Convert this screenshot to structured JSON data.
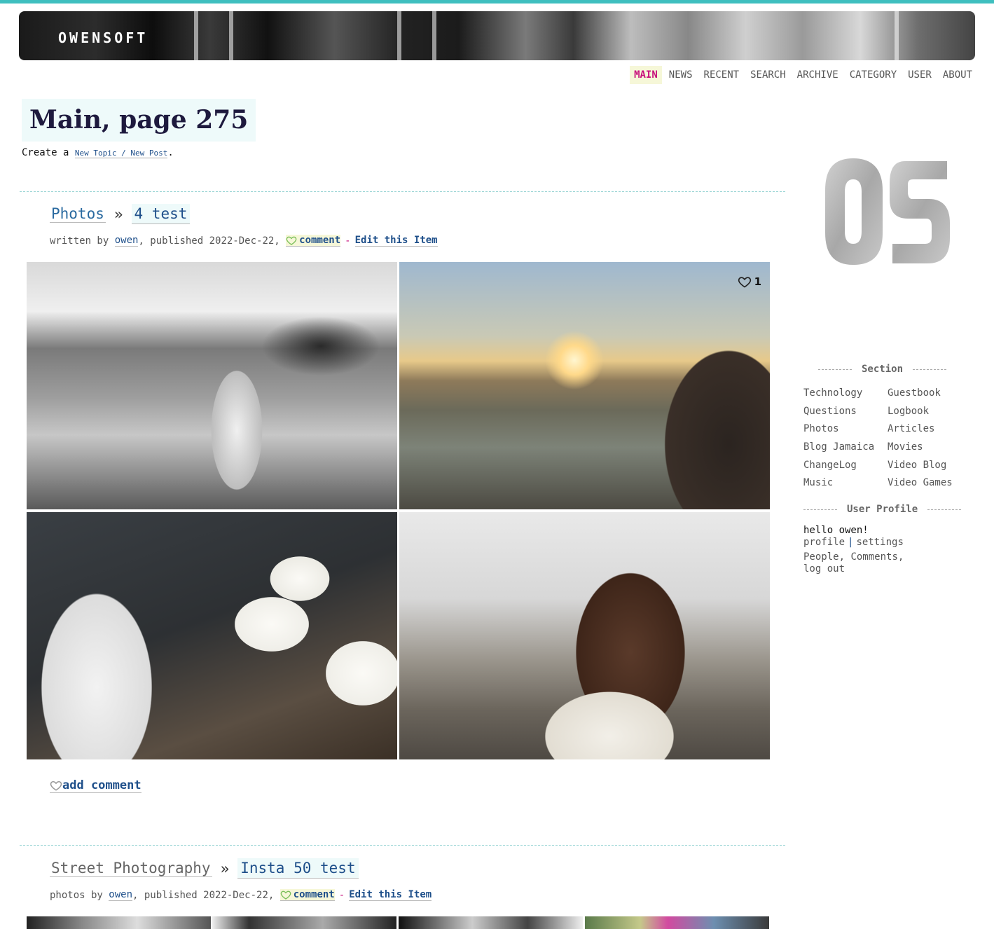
{
  "site": {
    "brand": "OWENSOFT"
  },
  "nav": [
    {
      "label": "MAIN",
      "active": true
    },
    {
      "label": "NEWS"
    },
    {
      "label": "RECENT"
    },
    {
      "label": "SEARCH"
    },
    {
      "label": "ARCHIVE"
    },
    {
      "label": "CATEGORY"
    },
    {
      "label": "USER"
    },
    {
      "label": "ABOUT"
    }
  ],
  "page": {
    "title": "Main, page 275",
    "create_prefix": "Create a ",
    "create_link": "New Topic / New Post",
    "create_suffix": "."
  },
  "posts": [
    {
      "section": "Photos",
      "sep": "»",
      "title": "4 test",
      "meta_prefix": "written by ",
      "author": "owen",
      "published": ", published 2022-Dec-22, ",
      "comment_label": "comment",
      "dash": "-",
      "edit_label": "Edit this Item",
      "like_count": "1",
      "add_comment": "add comment"
    },
    {
      "section": "Street Photography",
      "sep": "»",
      "title": "Insta 50 test",
      "meta_prefix": "photos by ",
      "author": "owen",
      "published": ", published 2022-Dec-22, ",
      "comment_label": "comment",
      "dash": "-",
      "edit_label": "Edit this Item"
    }
  ],
  "sidebar": {
    "section_heading": "Section",
    "sections": [
      "Technology",
      "Guestbook",
      "Questions",
      "Logbook",
      "Photos",
      "Articles",
      "Blog Jamaica",
      "Movies",
      "ChangeLog",
      "Video Blog",
      "Music",
      "Video Games"
    ],
    "profile_heading": "User Profile",
    "hello": "hello owen!",
    "profile_link": "profile",
    "pipe": "|",
    "settings_link": "settings",
    "people_link": "People",
    "comments_link": "Comments",
    "logout_link": "log out"
  },
  "icons": {
    "like": "heart-icon",
    "comment": "heart-outline-icon"
  },
  "colors": {
    "accent": "#3fbfbf",
    "active_nav": "#c8107c",
    "link": "#1e4f8a"
  }
}
